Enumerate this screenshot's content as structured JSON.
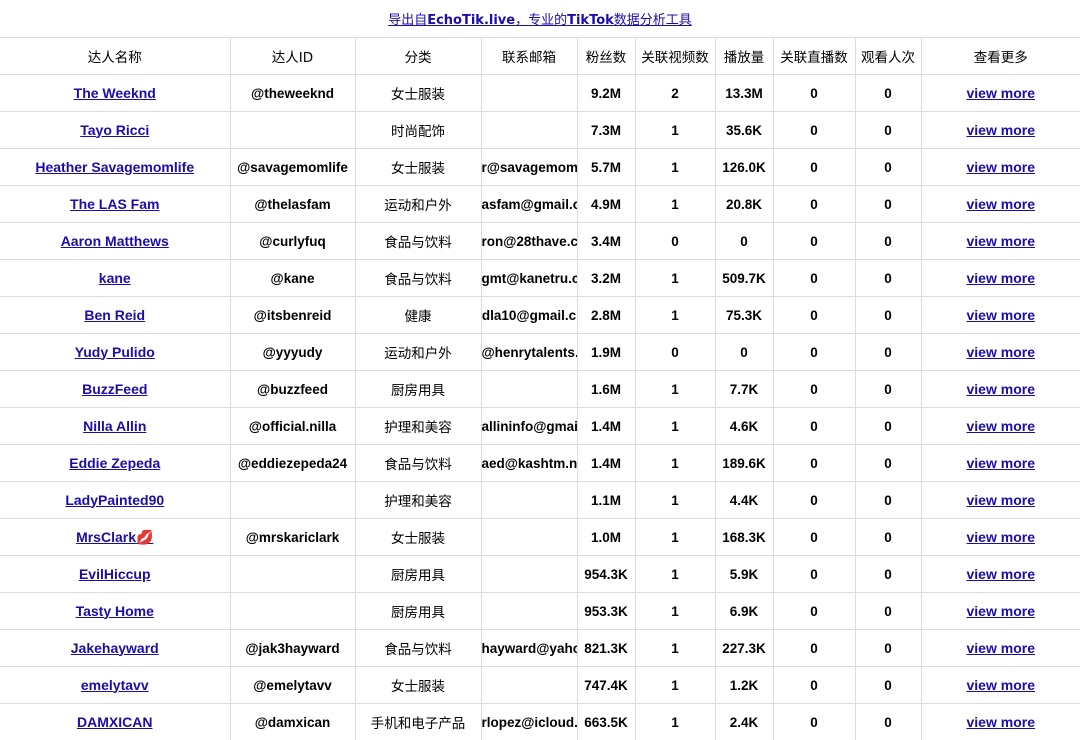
{
  "banner": {
    "prefix": "导出自",
    "site": "EchoTik.live",
    "middle": "，专业的",
    "brand": "TikTok",
    "suffix": "数据分析工具"
  },
  "headers": [
    "达人名称",
    "达人ID",
    "分类",
    "联系邮箱",
    "粉丝数",
    "关联视频数",
    "播放量",
    "关联直播数",
    "观看人次",
    "查看更多"
  ],
  "rows": [
    {
      "name": "The Weeknd",
      "id": "@theweeknd",
      "category": "女士服装",
      "email": "",
      "followers": "9.2M",
      "videos": "2",
      "views": "13.3M",
      "lives": "0",
      "viewers": "0",
      "more": "view more"
    },
    {
      "name": "Tayo Ricci",
      "id": "",
      "category": "时尚配饰",
      "email": "",
      "followers": "7.3M",
      "videos": "1",
      "views": "35.6K",
      "lives": "0",
      "viewers": "0",
      "more": "view more"
    },
    {
      "name": "Heather Savagemomlife",
      "id": "@savagemomlife",
      "category": "女士服装",
      "email": "r@savagemoml",
      "followers": "5.7M",
      "videos": "1",
      "views": "126.0K",
      "lives": "0",
      "viewers": "0",
      "more": "view more"
    },
    {
      "name": "The LAS Fam",
      "id": "@thelasfam",
      "category": "运动和户外",
      "email": "asfam@gmail.c",
      "followers": "4.9M",
      "videos": "1",
      "views": "20.8K",
      "lives": "0",
      "viewers": "0",
      "more": "view more"
    },
    {
      "name": "Aaron Matthews",
      "id": "@curlyfuq",
      "category": "食品与饮料",
      "email": "ron@28thave.c",
      "followers": "3.4M",
      "videos": "0",
      "views": "0",
      "lives": "0",
      "viewers": "0",
      "more": "view more"
    },
    {
      "name": "kane",
      "id": "@kane",
      "category": "食品与饮料",
      "email": "gmt@kanetru.c",
      "followers": "3.2M",
      "videos": "1",
      "views": "509.7K",
      "lives": "0",
      "viewers": "0",
      "more": "view more"
    },
    {
      "name": "Ben Reid",
      "id": "@itsbenreid",
      "category": "健康",
      "email": "dla10@gmail.c",
      "followers": "2.8M",
      "videos": "1",
      "views": "75.3K",
      "lives": "0",
      "viewers": "0",
      "more": "view more"
    },
    {
      "name": "Yudy Pulido",
      "id": "@yyyudy",
      "category": "运动和户外",
      "email": "@henrytalents.",
      "followers": "1.9M",
      "videos": "0",
      "views": "0",
      "lives": "0",
      "viewers": "0",
      "more": "view more"
    },
    {
      "name": "BuzzFeed",
      "id": "@buzzfeed",
      "category": "厨房用具",
      "email": "",
      "followers": "1.6M",
      "videos": "1",
      "views": "7.7K",
      "lives": "0",
      "viewers": "0",
      "more": "view more"
    },
    {
      "name": "Nilla Allin",
      "id": "@official.nilla",
      "category": "护理和美容",
      "email": "allininfo@gmail",
      "followers": "1.4M",
      "videos": "1",
      "views": "4.6K",
      "lives": "0",
      "viewers": "0",
      "more": "view more"
    },
    {
      "name": "Eddie Zepeda",
      "id": "@eddiezepeda24",
      "category": "食品与饮料",
      "email": "aed@kashtm.n",
      "followers": "1.4M",
      "videos": "1",
      "views": "189.6K",
      "lives": "0",
      "viewers": "0",
      "more": "view more"
    },
    {
      "name": "LadyPainted90",
      "id": "",
      "category": "护理和美容",
      "email": "",
      "followers": "1.1M",
      "videos": "1",
      "views": "4.4K",
      "lives": "0",
      "viewers": "0",
      "more": "view more"
    },
    {
      "name": "MrsClark💋",
      "id": "@mrskariclark",
      "category": "女士服装",
      "email": "",
      "followers": "1.0M",
      "videos": "1",
      "views": "168.3K",
      "lives": "0",
      "viewers": "0",
      "more": "view more"
    },
    {
      "name": "EvilHiccup",
      "id": "",
      "category": "厨房用具",
      "email": "",
      "followers": "954.3K",
      "videos": "1",
      "views": "5.9K",
      "lives": "0",
      "viewers": "0",
      "more": "view more"
    },
    {
      "name": "Tasty Home",
      "id": "",
      "category": "厨房用具",
      "email": "",
      "followers": "953.3K",
      "videos": "1",
      "views": "6.9K",
      "lives": "0",
      "viewers": "0",
      "more": "view more"
    },
    {
      "name": "Jakehayward",
      "id": "@jak3hayward",
      "category": "食品与饮料",
      "email": "hayward@yahoo",
      "followers": "821.3K",
      "videos": "1",
      "views": "227.3K",
      "lives": "0",
      "viewers": "0",
      "more": "view more"
    },
    {
      "name": "emelytavv",
      "id": "@emelytavv",
      "category": "女士服装",
      "email": "",
      "followers": "747.4K",
      "videos": "1",
      "views": "1.2K",
      "lives": "0",
      "viewers": "0",
      "more": "view more"
    },
    {
      "name": "DAMXICAN",
      "id": "@damxican",
      "category": "手机和电子产品",
      "email": "rlopez@icloud.",
      "followers": "663.5K",
      "videos": "1",
      "views": "2.4K",
      "lives": "0",
      "viewers": "0",
      "more": "view more"
    }
  ]
}
